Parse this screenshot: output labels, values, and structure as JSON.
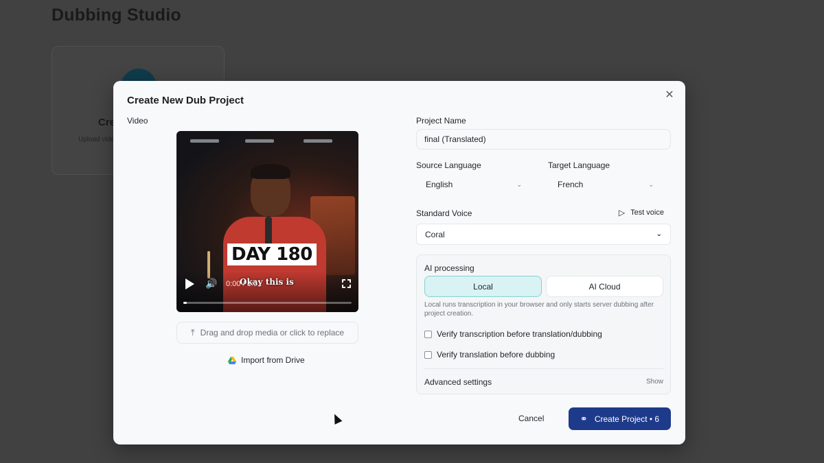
{
  "background": {
    "page_title": "Dubbing Studio",
    "card_title": "Cre",
    "card_subtitle": "Upload vide"
  },
  "modal": {
    "title": "Create New Dub Project",
    "close_icon": "close-icon",
    "video": {
      "label": "Video",
      "overlay_text": "DAY 180",
      "caption": "Okay this is",
      "time": "0:00 / 1:01",
      "progress": 0.0,
      "dropzone_text": "Drag and drop media or click to replace",
      "import_drive": "Import from Drive"
    },
    "form": {
      "project_name_label": "Project Name",
      "project_name_value": "final (Translated)",
      "source_language_label": "Source Language",
      "source_language_value": "English",
      "target_language_label": "Target Language",
      "target_language_value": "French",
      "standard_voice_label": "Standard Voice",
      "test_voice": "Test voice",
      "voice_value": "Coral",
      "ai_processing": {
        "title": "AI processing",
        "options": [
          "Local",
          "AI Cloud"
        ],
        "selected": "Local",
        "description": "Local runs transcription in your browser and only starts server dubbing after project creation.",
        "verify_transcription": "Verify transcription before translation/dubbing",
        "verify_translation": "Verify translation before dubbing",
        "advanced_settings": "Advanced settings",
        "show": "Show"
      }
    },
    "actions": {
      "cancel": "Cancel",
      "create": "Create Project • 6"
    }
  },
  "colors": {
    "primary": "#1e3a8a",
    "local_selected_bg": "#d9f2f3",
    "local_selected_border": "#7fd3d6",
    "backdrop": "#414141"
  }
}
